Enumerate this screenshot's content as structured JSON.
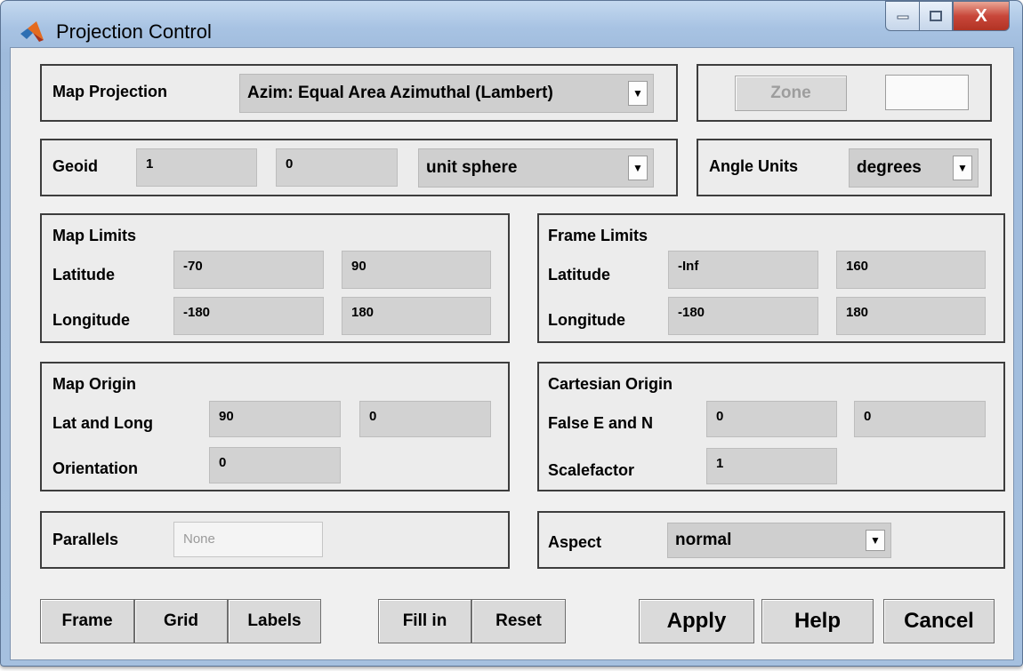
{
  "window": {
    "title": "Projection Control",
    "close_glyph": "X"
  },
  "projection": {
    "label": "Map Projection",
    "value": "Azim: Equal Area Azimuthal (Lambert)"
  },
  "zone": {
    "button_label": "Zone",
    "value": ""
  },
  "geoid": {
    "label": "Geoid",
    "field1": "1",
    "field2": "0",
    "model": "unit sphere"
  },
  "angle_units": {
    "label": "Angle Units",
    "value": "degrees"
  },
  "map_limits": {
    "title": "Map Limits",
    "lat_label": "Latitude",
    "lat_min": "-70",
    "lat_max": "90",
    "lon_label": "Longitude",
    "lon_min": "-180",
    "lon_max": "180"
  },
  "frame_limits": {
    "title": "Frame Limits",
    "lat_label": "Latitude",
    "lat_min": "-Inf",
    "lat_max": "160",
    "lon_label": "Longitude",
    "lon_min": "-180",
    "lon_max": "180"
  },
  "map_origin": {
    "title": "Map Origin",
    "latlong_label": "Lat and Long",
    "lat": "90",
    "long": "0",
    "orientation_label": "Orientation",
    "orientation": "0"
  },
  "cartesian_origin": {
    "title": "Cartesian Origin",
    "false_en_label": "False E and N",
    "false_e": "0",
    "false_n": "0",
    "scalefactor_label": "Scalefactor",
    "scalefactor": "1"
  },
  "parallels": {
    "label": "Parallels",
    "value": "None"
  },
  "aspect": {
    "label": "Aspect",
    "value": "normal"
  },
  "buttons": {
    "frame": "Frame",
    "grid": "Grid",
    "labels": "Labels",
    "fill_in": "Fill in",
    "reset": "Reset",
    "apply": "Apply",
    "help": "Help",
    "cancel": "Cancel"
  }
}
